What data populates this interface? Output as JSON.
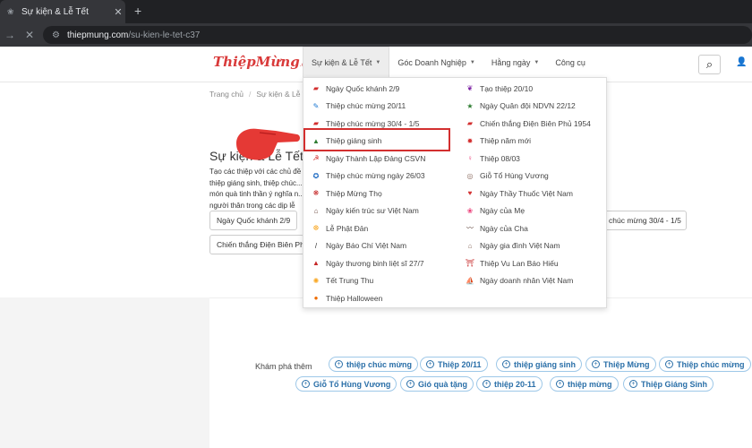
{
  "browser": {
    "tab_title": "Sự kiện & Lễ Tết",
    "tab_close": "✕",
    "new_tab": "+",
    "url_host": "thiepmung.com",
    "url_path": "/su-kien-le-tet-c37"
  },
  "header": {
    "logo": "ThiệpMừng",
    "logo_suffix": ".com",
    "nav": [
      {
        "label": "Sự kiện & Lễ Tết"
      },
      {
        "label": "Góc Doanh Nghiệp"
      },
      {
        "label": "Hằng ngày"
      },
      {
        "label": "Công cụ"
      }
    ]
  },
  "breadcrumb": [
    "Trang chủ",
    "Sự kiện & Lễ Tết"
  ],
  "page": {
    "title": "Sự kiện & Lễ Tết",
    "description": "Tạo các thiệp với các chủ đề thiệp giáng sinh, thiệp chúc... món quà tinh thần ý nghĩa n... người thân trong các dịp lễ",
    "tags_row1": [
      "Ngày Quốc khánh 2/9",
      "chúc mừng 30/4 - 1/5"
    ],
    "tags_row2": [
      "Chiến thắng Điện Biên Ph"
    ]
  },
  "menu": {
    "left": [
      {
        "label": "Ngày Quốc khánh 2/9",
        "icon": "flag-icon",
        "color": "#d32f2f"
      },
      {
        "label": "Thiệp chúc mừng 20/11",
        "icon": "teacher-icon",
        "color": "#1976d2"
      },
      {
        "label": "Thiệp chúc mừng 30/4 - 1/5",
        "icon": "flag-icon",
        "color": "#d32f2f"
      },
      {
        "label": "Thiệp giáng sinh",
        "icon": "tree-icon",
        "color": "#2e7d32"
      },
      {
        "label": "Ngày Thành Lập Đảng CSVN",
        "icon": "hammer-sickle-icon",
        "color": "#d32f2f"
      },
      {
        "label": "Thiệp chúc mừng ngày 26/03",
        "icon": "youth-union-icon",
        "color": "#1565c0"
      },
      {
        "label": "Thiệp Mừng Thọ",
        "icon": "longevity-icon",
        "color": "#c62828"
      },
      {
        "label": "Ngày kiến trúc sư Việt Nam",
        "icon": "architect-icon",
        "color": "#6d4c41"
      },
      {
        "label": "Lễ Phật Đản",
        "icon": "buddha-icon",
        "color": "#f9a825"
      },
      {
        "label": "Ngày Báo Chí Việt Nam",
        "icon": "pen-icon",
        "color": "#333333"
      },
      {
        "label": "Ngày thương binh liệt sĩ 27/7",
        "icon": "monument-icon",
        "color": "#c62828"
      },
      {
        "label": "Tết Trung Thu",
        "icon": "lantern-icon",
        "color": "#f9a825"
      },
      {
        "label": "Thiệp Halloween",
        "icon": "pumpkin-icon",
        "color": "#ef6c00"
      }
    ],
    "right": [
      {
        "label": "Tạo thiệp 20/10",
        "icon": "feather-icon",
        "color": "#7b1fa2"
      },
      {
        "label": "Ngày Quân đội NDVN 22/12",
        "icon": "soldier-icon",
        "color": "#2e7d32"
      },
      {
        "label": "Chiến thắng Điện Biên Phủ 1954",
        "icon": "flag-icon",
        "color": "#d32f2f"
      },
      {
        "label": "Thiệp năm mới",
        "icon": "new-year-icon",
        "color": "#d32f2f"
      },
      {
        "label": "Thiệp 08/03",
        "icon": "woman-icon",
        "color": "#ec407a"
      },
      {
        "label": "Giỗ Tổ Hùng Vương",
        "icon": "drum-icon",
        "color": "#8d6e63"
      },
      {
        "label": "Ngày Thầy Thuốc Việt Nam",
        "icon": "heart-icon",
        "color": "#d32f2f"
      },
      {
        "label": "Ngày của Mẹ",
        "icon": "mother-icon",
        "color": "#ec407a"
      },
      {
        "label": "Ngày của Cha",
        "icon": "mustache-icon",
        "color": "#5d4037"
      },
      {
        "label": "Ngày gia đình Việt Nam",
        "icon": "family-icon",
        "color": "#8d6e63"
      },
      {
        "label": "Thiệp Vu Lan Báo Hiếu",
        "icon": "pagoda-icon",
        "color": "#c62828"
      },
      {
        "label": "Ngày doanh nhân Việt Nam",
        "icon": "sail-icon",
        "color": "#1976d2"
      }
    ]
  },
  "explore": {
    "label": "Khám phá thêm",
    "row1": [
      "thiệp chúc mừng",
      "Thiệp 20/11",
      "thiệp giáng sinh",
      "Thiệp Mừng",
      "Thiệp chúc mừng"
    ],
    "row2": [
      "Giỗ Tổ Hùng Vương",
      "Gió quà tặng",
      "thiệp 20-11",
      "thiệp mừng",
      "Thiệp Giáng Sinh"
    ]
  },
  "accent_color": "#d32f2f",
  "link_color": "#2a6fa8"
}
